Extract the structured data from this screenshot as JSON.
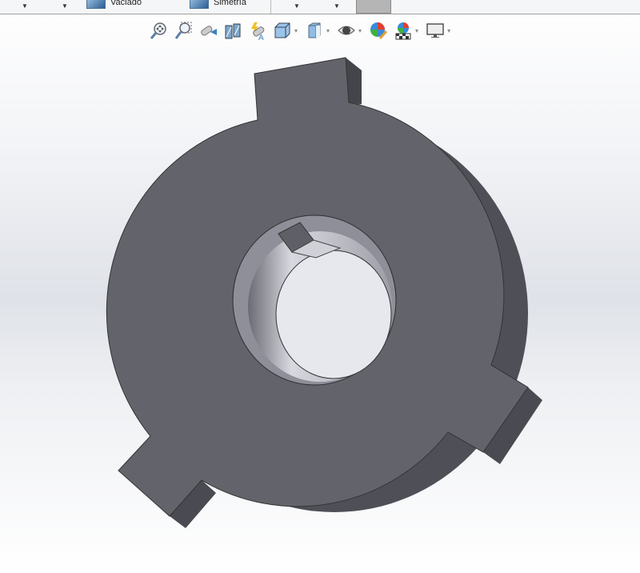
{
  "command_manager": {
    "items": [
      {
        "label": "Vaciado",
        "icon": "shell-icon"
      },
      {
        "label": "Simetría",
        "icon": "mirror-icon"
      }
    ],
    "dropdown_glyph": "▼",
    "appearance_swatch_color": "#b5b5b5"
  },
  "heads_up_toolbar": {
    "tools": [
      {
        "name": "zoom-to-fit",
        "icon": "zoom-fit-icon"
      },
      {
        "name": "zoom-to-area",
        "icon": "zoom-area-icon"
      },
      {
        "name": "previous-view",
        "icon": "previous-view-icon"
      },
      {
        "name": "section-view",
        "icon": "section-view-icon"
      },
      {
        "name": "dynamic-annotation-views",
        "icon": "annotation-view-icon"
      },
      {
        "name": "view-orientation",
        "icon": "view-orientation-icon",
        "dropdown": true
      },
      {
        "name": "display-style",
        "icon": "display-style-icon",
        "dropdown": true
      },
      {
        "name": "hide-show-items",
        "icon": "eye-icon",
        "dropdown": true
      },
      {
        "name": "edit-appearance",
        "icon": "appearance-icon"
      },
      {
        "name": "apply-scene",
        "icon": "scene-icon",
        "dropdown": true
      },
      {
        "name": "view-settings",
        "icon": "monitor-icon",
        "dropdown": true
      }
    ],
    "dropdown_glyph": "▾"
  },
  "model": {
    "face_color": "#62636a",
    "side_color": "#4d4e55",
    "bore_color": "#b9bac3"
  }
}
